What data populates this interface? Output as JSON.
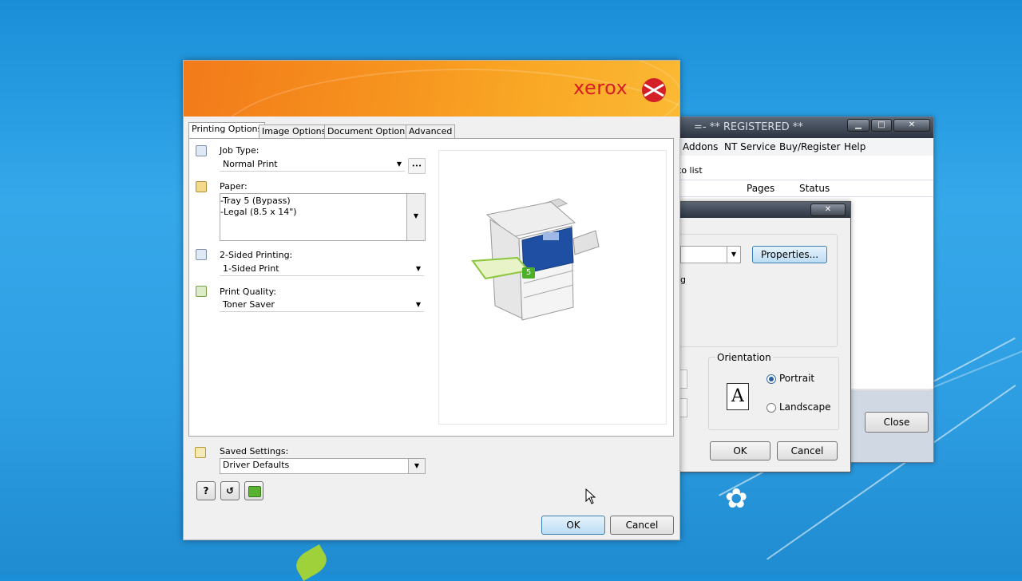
{
  "background_window": {
    "title": "=- ** REGISTERED **",
    "menu": [
      "Addons",
      "NT Service",
      "Buy/Register",
      "Help"
    ],
    "list_label": "to list",
    "columns": [
      "Pages",
      "Status"
    ],
    "close_label": "Close"
  },
  "print_dialog": {
    "properties_label": "Properties...",
    "fragment_text": "g",
    "orientation_title": "Orientation",
    "portrait_label": "Portrait",
    "landscape_label": "Landscape",
    "orientation_glyph": "A",
    "ok_label": "OK",
    "cancel_label": "Cancel"
  },
  "xerox_dialog": {
    "logo": "xerox",
    "tabs": [
      "Printing Options",
      "Image Options",
      "Document Options",
      "Advanced"
    ],
    "job_type": {
      "label": "Job Type:",
      "value": "Normal Print",
      "more": "•••"
    },
    "paper": {
      "label": "Paper:",
      "lines": [
        "-Tray 5 (Bypass)",
        "-Legal (8.5 x 14\")"
      ]
    },
    "two_sided": {
      "label": "2-Sided Printing:",
      "value": "1-Sided Print"
    },
    "print_quality": {
      "label": "Print Quality:",
      "value": "Toner Saver"
    },
    "tray_badge": "5",
    "saved_settings": {
      "label": "Saved Settings:",
      "value": "Driver Defaults"
    },
    "help_glyph": "?",
    "reset_glyph": "↺",
    "ok_label": "OK",
    "cancel_label": "Cancel"
  }
}
